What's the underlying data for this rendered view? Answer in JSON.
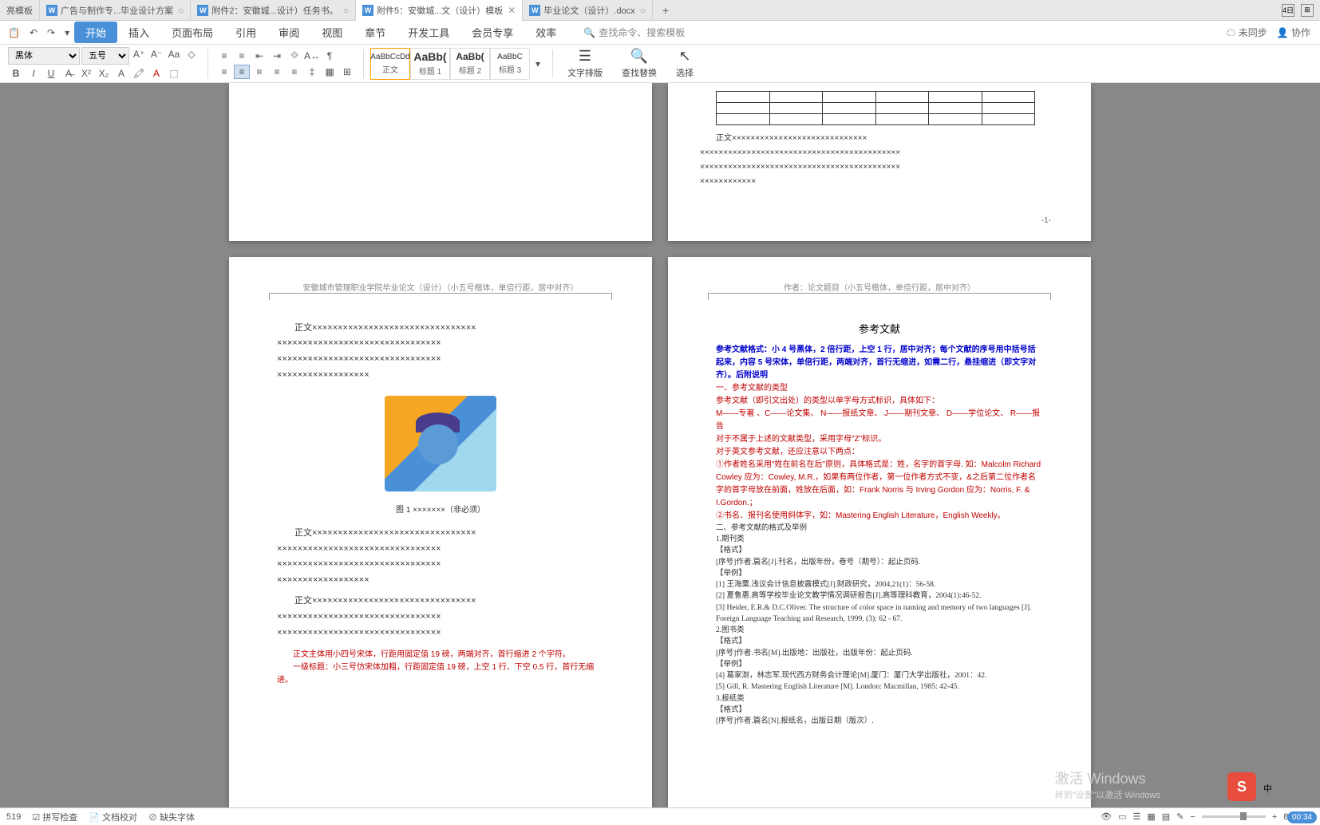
{
  "tabs": [
    {
      "label": "亮模板"
    },
    {
      "label": "广告与制作专...毕业设计方案"
    },
    {
      "label": "附件2：安徽城...设计）任务书。"
    },
    {
      "label": "附件5：安徽城...文（设计）模板",
      "active": true
    },
    {
      "label": "毕业论文（设计）.docx"
    }
  ],
  "quick": {
    "undo": "↶",
    "redo": "↷"
  },
  "ribbonTabs": [
    "开始",
    "插入",
    "页面布局",
    "引用",
    "审阅",
    "视图",
    "章节",
    "开发工具",
    "会员专享",
    "效率"
  ],
  "searchPlaceholder": "查找命令、搜索模板",
  "syncLabel": "未同步",
  "coopLabel": "协作",
  "font": {
    "name": "黑体",
    "size": "五号"
  },
  "styles": [
    {
      "preview": "AaBbCcDd",
      "label": "正文",
      "active": true
    },
    {
      "preview": "AaBb(",
      "label": "标题 1"
    },
    {
      "preview": "AaBb(",
      "label": "标题 2"
    },
    {
      "preview": "AaBbC",
      "label": "标题 3"
    }
  ],
  "bigButtons": {
    "layout": "文字排版",
    "find": "查找替换",
    "select": "选择"
  },
  "page1Header": "安徽城市管理职业学院毕业论文（设计）（小五号楷体，单倍行距，居中对齐）",
  "page2Header": "作者：论文题目（小五号楷体，单倍行距，居中对齐）",
  "bodyPrefix": "正文",
  "xLine": "××××××××××××××××××××××××××××××××",
  "imgCaption": "图 1 ×××××××（非必须）",
  "redNote1": "正文主体用小四号宋体，行距用固定值 19 磅，两端对齐，首行缩进 2 个字符。",
  "redNote2": "一级标题：小三号仿宋体加粗，行距固定值 19 磅，上空 1 行、下空 0.5 行，首行无缩进。",
  "refTitle": "参考文献",
  "refFormat1": "参考文献格式：小 4 号黑体，2 倍行距，上空 1 行，居中对齐；每个文献的序号用中括号括起来，内容 5 号宋体，单倍行距，两端对齐，首行无缩进，如需二行，悬挂缩进（即文字对齐）。后附说明",
  "refRed": [
    "一、参考文献的类型",
    "参考文献（即引文出处）的类型以单字母方式标识，具体如下：",
    "M——专著 、C——论文集、 N——报纸文章、 J——期刊文章、 D——学位论文、 R——报告",
    "对于不属于上述的文献类型，采用字母\"Z\"标识。",
    "对于英文参考文献，还应注意以下两点：",
    "①作者姓名采用\"姓在前名在后\"原则，具体格式是：姓，名字的首字母. 如：Malcolm Richard Cowley 应为：Cowley, M.R.，如果有两位作者，第一位作者方式不变，&之后第二位作者名字的首字母放在前面，姓放在后面，如：Frank Norris 与 Irving Gordon 应为：Norris, F. & I.Gordon.；",
    "②书名、报刊名使用斜体字，如：Mastering English Literature，English Weekly。"
  ],
  "refBlack": [
    "二、参考文献的格式及举例",
    "1.期刊类",
    "【格式】",
    "[序号]作者.篇名[J].刊名，出版年份，卷号（期号）：起止页码.",
    "【举例】",
    "[1] 王海粟.浅议会计信息披露模式[J].财政研究，2004,21(1)：56-58.",
    "[2] 夏鲁惠.高等学校毕业论文教学情况调研报告[J].高等理科教育，2004(1):46-52.",
    "[3] Heider, E.R.& D.C.Oliver. The structure of color space in naming and memory of two languages [J]. Foreign Language Teaching and Research, 1999, (3): 62 - 67.",
    "2.图书类",
    "【格式】",
    "[序号]作者.书名[M].出版地：出版社，出版年份：起止页码.",
    "【举例】",
    "[4] 葛家澍，林志军.现代西方财务会计理论[M].厦门：厦门大学出版社，2001：42.",
    "[5] Gill, R. Mastering English Literature [M]. London: Macmillan, 1985: 42-45.",
    "3.报纸类",
    "【格式】",
    "[序号]作者.篇名[N].报纸名，出版日期（版次）."
  ],
  "pageNum": "-1-",
  "status": {
    "page": "519",
    "check": "拼写检查",
    "proof": "文档校对",
    "font": "缺失字体",
    "zoom": "80%"
  },
  "watermark": {
    "title": "激活 Windows",
    "sub": "转到\"设置\"以激活 Windows"
  },
  "ime": "S",
  "imeLabel": "中",
  "time": "00:34"
}
